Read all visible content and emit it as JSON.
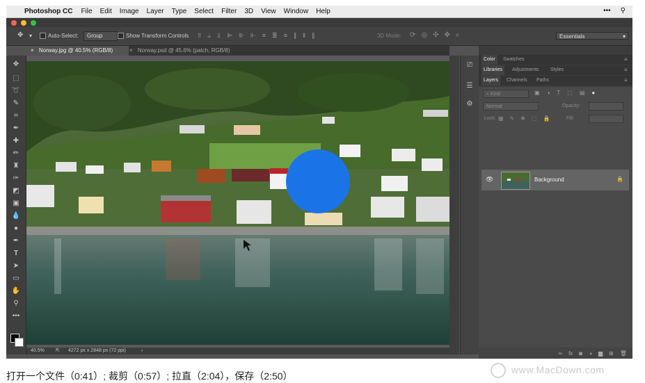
{
  "menubar": {
    "apple_icon": "apple-icon",
    "app_name": "Photoshop CC",
    "items": [
      "File",
      "Edit",
      "Image",
      "Layer",
      "Type",
      "Select",
      "Filter",
      "3D",
      "View",
      "Window",
      "Help"
    ],
    "right_icons": [
      "more-icon",
      "search-icon"
    ]
  },
  "options_bar": {
    "auto_select_label": "Auto-Select:",
    "auto_select_value": "Group",
    "show_transform_label": "Show Transform Controls",
    "mode_3d_label": "3D Mode:",
    "workspace_value": "Essentials"
  },
  "tabs": [
    {
      "label": "Norway.jpg @ 40.5% (RGB/8)",
      "active": true
    },
    {
      "label": "Norway.psd @ 45.6% (patch, RGB/8)",
      "active": false
    }
  ],
  "status": {
    "zoom": "40.5%",
    "doc_size": "4272 px x 2848 px (72 ppi)"
  },
  "panels": {
    "group1_tabs": [
      "Color",
      "Swatches"
    ],
    "group2_tabs": [
      "Libraries",
      "Adjustments",
      "Styles"
    ],
    "group3_tabs": [
      "Layers",
      "Channels",
      "Paths"
    ],
    "filter_kind": "Kind",
    "blend_mode": "Normal",
    "opacity_label": "Opacity:",
    "lock_label": "Lock:",
    "fill_label": "Fill:",
    "layer_name": "Background"
  },
  "caption": {
    "text": "打开一个文件（0:41）; 裁剪（0:57）; 拉直（2:04），保存（2:50）"
  },
  "watermark": {
    "text": "www.MacDown.com"
  },
  "colors": {
    "accent_circle": "#1a74e8",
    "panel_bg": "#3c3c3c",
    "menubar_bg": "#ececec"
  }
}
